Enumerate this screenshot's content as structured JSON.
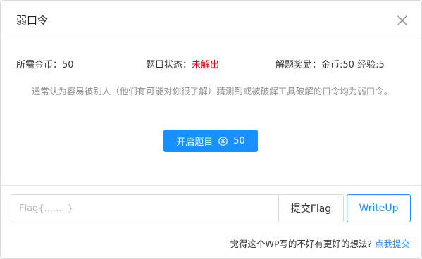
{
  "dialog": {
    "title": "弱口令"
  },
  "info": {
    "coins_required_label": "所需金币：",
    "coins_required_value": "50",
    "status_label": "题目状态：",
    "status_value": "未解出",
    "reward_label": "解题奖励：",
    "reward_value": "金币:50 经验:5"
  },
  "description": "通常认为容易被别人（他们有可能对你很了解）猜测到或被破解工具破解的口令均为弱口令。",
  "start_button": {
    "label": "开启题目",
    "cost": "50",
    "icon": "yen-circle-icon"
  },
  "flag_form": {
    "placeholder": "Flag{........}",
    "value": "",
    "submit_label": "提交Flag",
    "writeup_label": "WriteUp"
  },
  "feedback": {
    "question": "觉得这个WP写的不好有更好的想法?",
    "link_label": "点我提交"
  },
  "colors": {
    "primary": "#1890ff",
    "status_unsolved": "#e60012"
  }
}
